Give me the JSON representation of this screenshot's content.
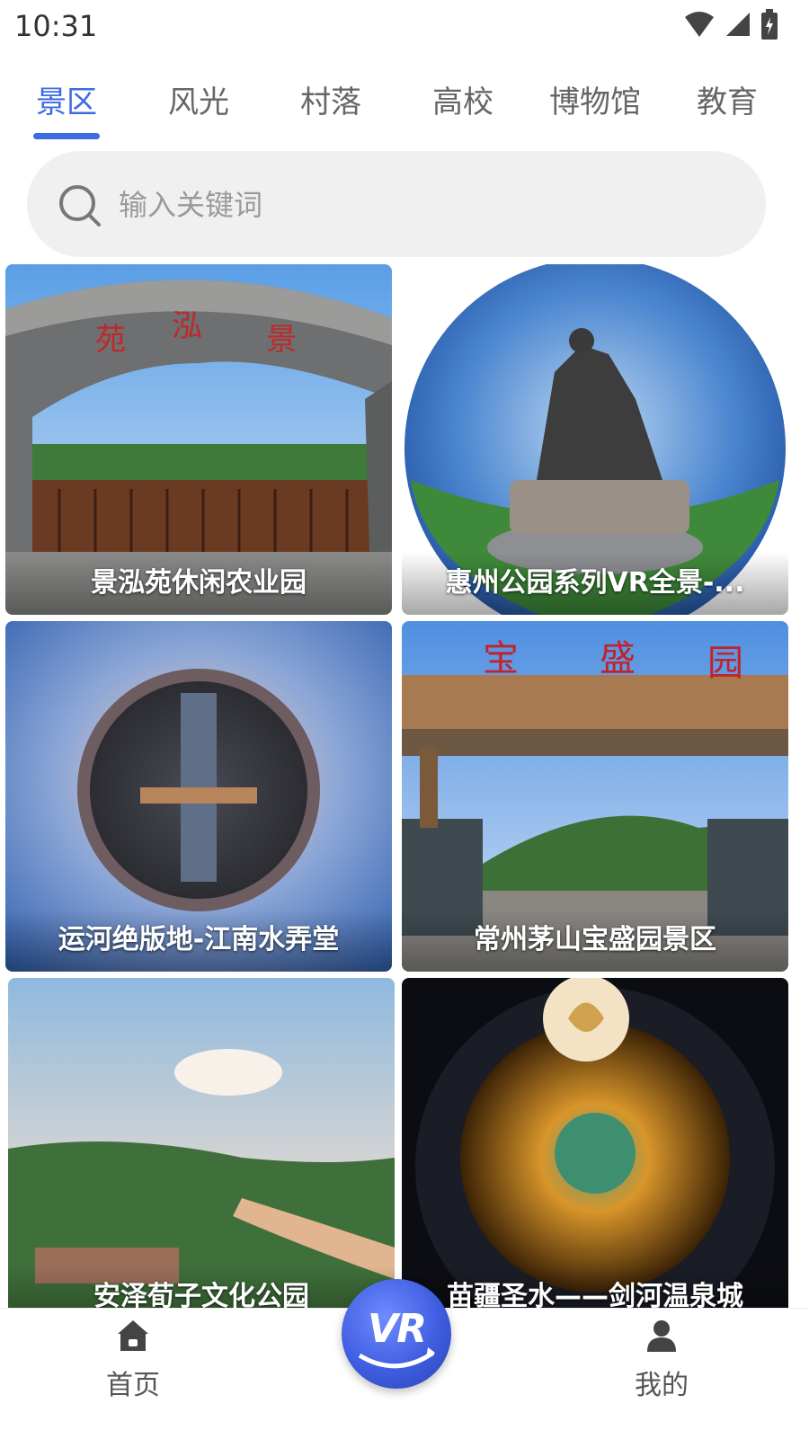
{
  "status_bar": {
    "time": "10:31"
  },
  "tabs": [
    {
      "label": "景区",
      "active": true
    },
    {
      "label": "风光",
      "active": false
    },
    {
      "label": "村落",
      "active": false
    },
    {
      "label": "高校",
      "active": false
    },
    {
      "label": "博物馆",
      "active": false
    },
    {
      "label": "教育",
      "active": false
    }
  ],
  "search": {
    "placeholder": "输入关键词",
    "value": ""
  },
  "cards": [
    {
      "title": "景泓苑休闲农业园"
    },
    {
      "title": "惠州公园系列VR全景-..."
    },
    {
      "title": "运河绝版地-江南水弄堂"
    },
    {
      "title": "常州茅山宝盛园景区"
    },
    {
      "title": "安泽荀子文化公园"
    },
    {
      "title": "苗疆圣水——剑河温泉城"
    }
  ],
  "bottom_nav": {
    "home_label": "首页",
    "vr_label": "VR",
    "profile_label": "我的"
  },
  "colors": {
    "accent": "#3d6ce0"
  }
}
